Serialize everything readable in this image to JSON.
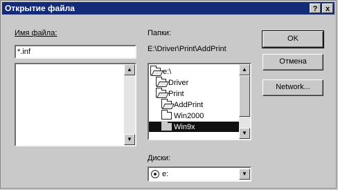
{
  "window": {
    "title": "Открытие файла",
    "help_btn": "?",
    "close_btn": "x"
  },
  "filename": {
    "label": "Имя файла:",
    "value": "*.inf"
  },
  "folders": {
    "label": "Папки:",
    "path": "E:\\Driver\\Print\\AddPrint",
    "items": [
      {
        "label": "e:\\",
        "selected": false
      },
      {
        "label": "Driver",
        "selected": false
      },
      {
        "label": "Print",
        "selected": false
      },
      {
        "label": "AddPrint",
        "selected": false
      },
      {
        "label": "Win2000",
        "selected": false
      },
      {
        "label": "Win9x",
        "selected": true
      }
    ]
  },
  "drives": {
    "label": "Диски:",
    "value": "e:"
  },
  "buttons": {
    "ok": "OK",
    "cancel": "Отмена",
    "network": "Network..."
  },
  "scroll": {
    "up_arrow": "▲",
    "down_arrow": "▼"
  }
}
